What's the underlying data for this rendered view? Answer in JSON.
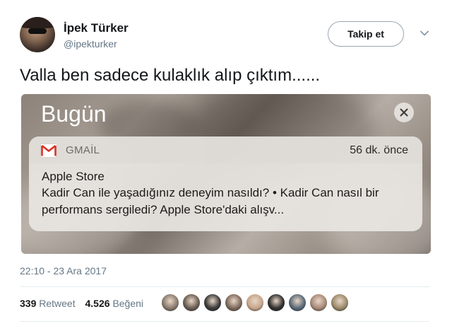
{
  "user": {
    "display_name": "İpek Türker",
    "username": "@ipekturker"
  },
  "follow_button": {
    "label": "Takip et"
  },
  "tweet": {
    "text": "Valla ben sadece kulaklık alıp çıktım......",
    "timestamp": "22:10 - 23 Ara 2017"
  },
  "media": {
    "header": "Bugün",
    "notification": {
      "app_name": "GMAİL",
      "time": "56 dk. önce",
      "title": "Apple Store",
      "body": "Kadir Can ile yaşadığınız deneyim nasıldı? • Kadir Can nasıl bir performans sergiledi? Apple Store'daki alışv..."
    }
  },
  "stats": {
    "retweets_count": "339",
    "retweets_label": "Retweet",
    "likes_count": "4.526",
    "likes_label": "Beğeni"
  },
  "likers": [
    {
      "color": "#8a7a6e"
    },
    {
      "color": "#6b5d52"
    },
    {
      "color": "#3a3a3a"
    },
    {
      "color": "#7d6a5c"
    },
    {
      "color": "#c7a68b"
    },
    {
      "color": "#2f2f2f"
    },
    {
      "color": "#5a6a78"
    },
    {
      "color": "#a88978"
    },
    {
      "color": "#9b8a6a"
    }
  ],
  "colors": {
    "gmail_red": "#d93025",
    "secondary_text": "#657786"
  }
}
